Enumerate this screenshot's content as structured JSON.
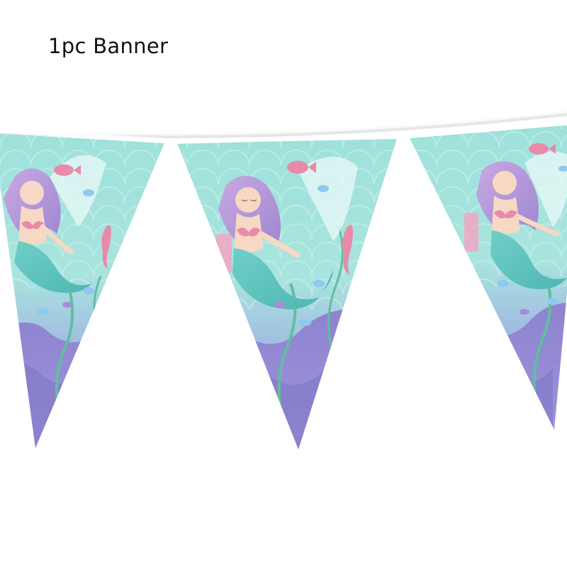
{
  "caption": "1pc Banner",
  "product": {
    "pennant_count_visible": 3,
    "theme": "mermaid",
    "colors": {
      "aqua": "#8fdcd6",
      "aqua_light": "#c5eeea",
      "lavender": "#a89ad8",
      "purple": "#7d78c9",
      "pink": "#e88aa8",
      "hair": "#b99ad8",
      "tail": "#6ec9c4",
      "skin": "#f7d8c4",
      "string": "#f4f4f4"
    }
  }
}
